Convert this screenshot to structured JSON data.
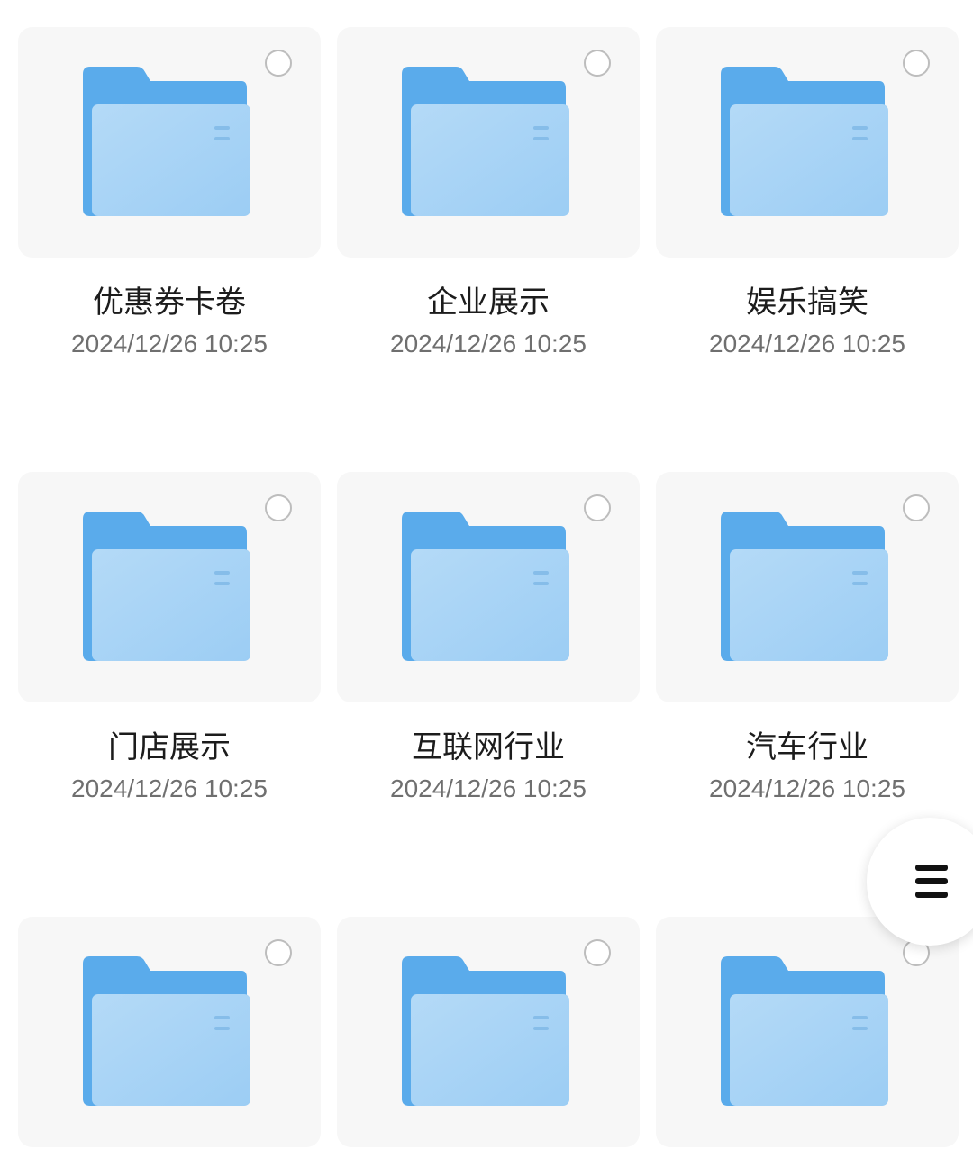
{
  "folders": [
    {
      "name": "优惠券卡卷",
      "date": "2024/12/26 10:25"
    },
    {
      "name": "企业展示",
      "date": "2024/12/26 10:25"
    },
    {
      "name": "娱乐搞笑",
      "date": "2024/12/26 10:25"
    },
    {
      "name": "门店展示",
      "date": "2024/12/26 10:25"
    },
    {
      "name": "互联网行业",
      "date": "2024/12/26 10:25"
    },
    {
      "name": "汽车行业",
      "date": "2024/12/26 10:25"
    },
    {
      "name": "",
      "date": ""
    },
    {
      "name": "",
      "date": ""
    },
    {
      "name": "",
      "date": ""
    }
  ],
  "icons": {
    "folder": "folder-icon",
    "select": "select-circle-icon",
    "menu": "menu-icon"
  },
  "colors": {
    "folder_back": "#5aabeb",
    "folder_front": "#a9d4f6",
    "tile_background": "#f7f7f7",
    "title_text": "#1c1c1c",
    "date_text": "#6f6f6f"
  }
}
